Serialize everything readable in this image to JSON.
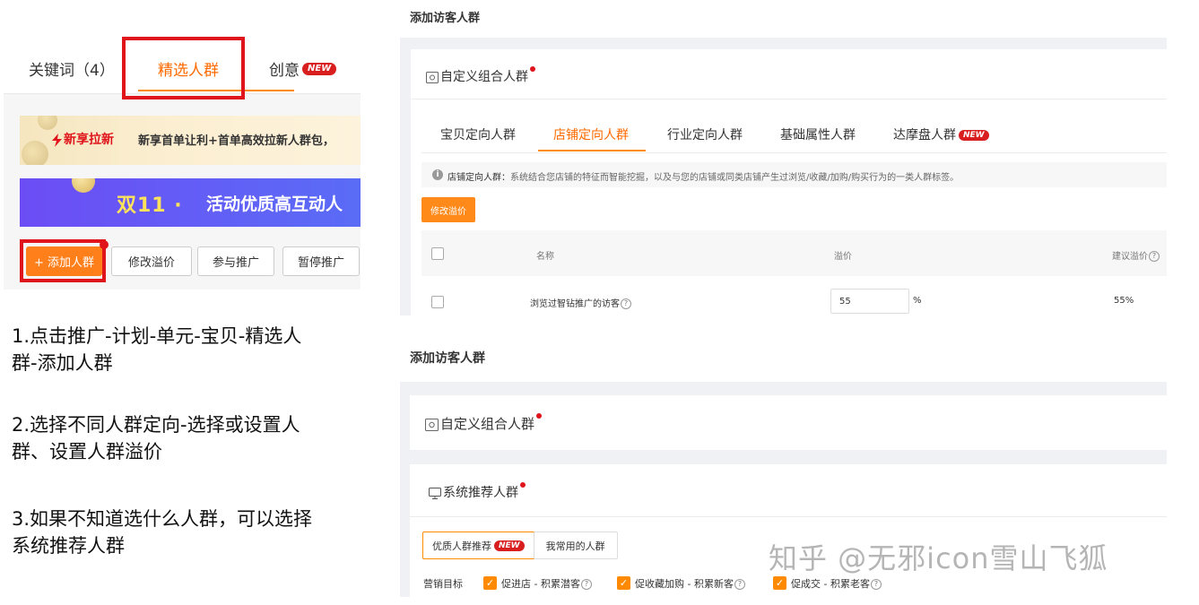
{
  "left": {
    "tabs": {
      "keywords": "关键词（4）",
      "crowd": "精选人群",
      "creative": "创意",
      "creative_badge": "NEW"
    },
    "promo1": {
      "tag": "新享拉新",
      "text": "新享首单让利+首单高效拉新人群包，"
    },
    "promo2": {
      "title": "双11 ·",
      "text": "活动优质高互动人"
    },
    "buttons": {
      "add": "+ 添加人群",
      "edit": "修改溢价",
      "join": "参与推广",
      "pause": "暂停推广"
    }
  },
  "instructions": {
    "step1": "1.点击推广-计划-单元-宝贝-精选人群-添加人群",
    "step2": "2.选择不同人群定向-选择或设置人群、设置人群溢价",
    "step3": "3.如果不知道选什么人群，可以选择系统推荐人群"
  },
  "top_panel": {
    "heading": "添加访客人群",
    "card_title": "自定义组合人群",
    "subtabs": [
      "宝贝定向人群",
      "店铺定向人群",
      "行业定向人群",
      "基础属性人群",
      "达摩盘人群"
    ],
    "subtab_badge": "NEW",
    "info_label": "店铺定向人群：",
    "info_text": "系统结合您店铺的特征而智能挖掘，以及与您的店铺或同类店铺产生过浏览/收藏/加购/购买行为的一类人群标签。",
    "edit_button": "修改溢价",
    "table": {
      "col_name": "名称",
      "col_premium": "溢价",
      "col_suggest": "建议溢价",
      "row_name": "浏览过智钻推广的访客",
      "row_premium": "55",
      "row_unit": "%",
      "row_suggest": "55%"
    }
  },
  "bottom_panel": {
    "heading": "添加访客人群",
    "card1_title": "自定义组合人群",
    "card2_title": "系统推荐人群",
    "segments": {
      "quality": "优质人群推荐",
      "quality_badge": "NEW",
      "common": "我常用的人群"
    },
    "goal_label": "营销目标",
    "goals": [
      "促进店 - 积累潜客",
      "促收藏加购 - 积累新客",
      "促成交 - 积累老客"
    ]
  },
  "watermark": "知乎 @无邪icon雪山飞狐",
  "colors": {
    "accent": "#ff8a00",
    "highlight_box": "#e0141b",
    "promo_purple": "#6c4df5"
  }
}
